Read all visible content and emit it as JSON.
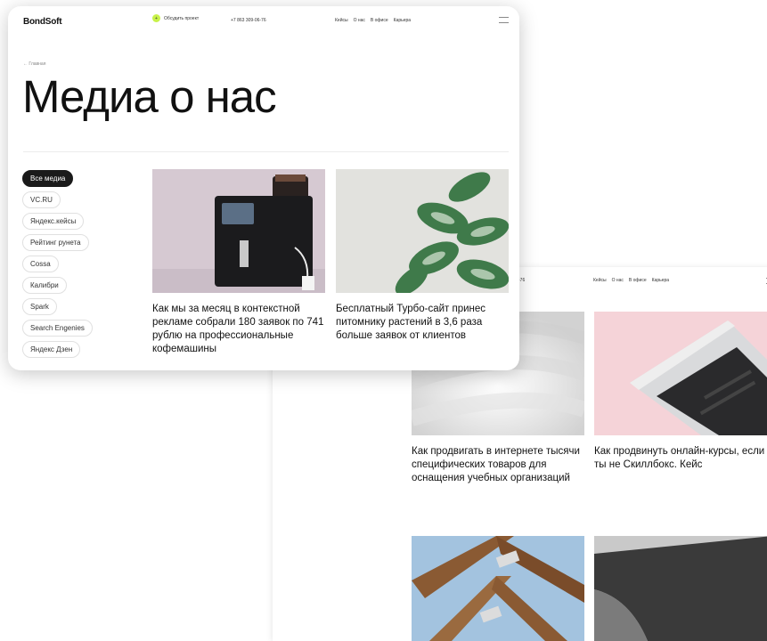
{
  "front": {
    "logo": "BondSoft",
    "cta": "Обсудить проект",
    "phone": "+7 863 309-06-76",
    "menu": [
      "Кейсы",
      "О нас",
      "В офисе",
      "Карьера"
    ],
    "breadcrumb": "← Главная",
    "title": "Медиа о нас",
    "filters": [
      "Все медиа",
      "VC.RU",
      "Яндекс.кейсы",
      "Рейтинг рунета",
      "Cossa",
      "Калибри",
      "Spark",
      "Search Engenies",
      "Яндекс Дзен"
    ],
    "cards": [
      {
        "title": "Как мы за месяц в контекстной рекламе собрали 180 заявок по 741 рублю на профессиональные кофемашины"
      },
      {
        "title": "Бесплатный Турбо-сайт принес питомнику растений в 3,6 раза больше заявок от клиентов"
      }
    ]
  },
  "back": {
    "phone_tail": "-76",
    "menu": [
      "Кейсы",
      "О нас",
      "В офисе",
      "Карьера"
    ],
    "cards": [
      {
        "title": "Как продвигать в интернете тысячи специфических товаров для оснащения учебных организаций"
      },
      {
        "title": "Как продвинуть онлайн-курсы, если ты не Скиллбокс. Кейс"
      }
    ]
  },
  "colors": {
    "accent": "#c8f24a",
    "chip_active": "#1a1a1a"
  }
}
